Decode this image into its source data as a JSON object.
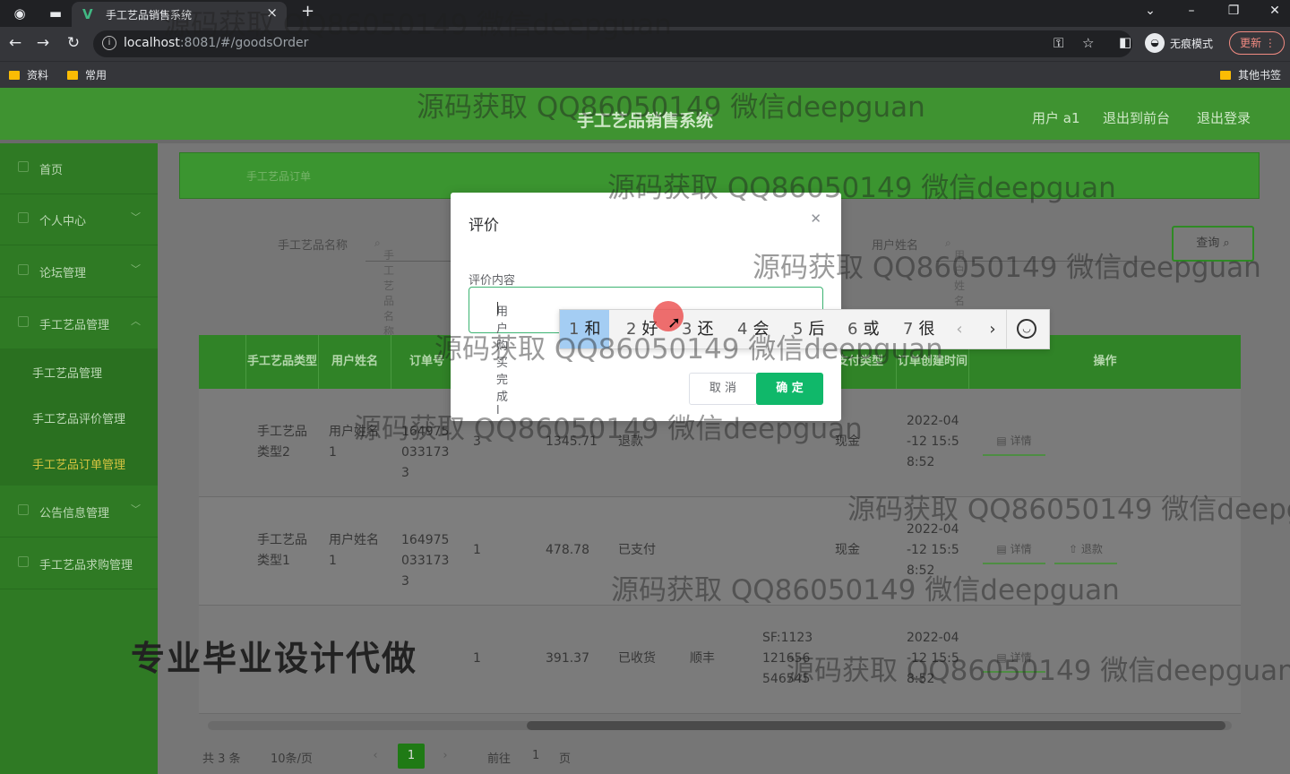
{
  "browser": {
    "tab_title": "手工艺品销售系统",
    "new_tab": "+",
    "url_host": "localhost",
    "url_rest": ":8081/#/goodsOrder",
    "incognito_label": "无痕模式",
    "update_label": "更新",
    "bookmarks": [
      "资料",
      "常用"
    ],
    "other_bookmarks": "其他书签"
  },
  "header": {
    "title": "手工艺品销售系统",
    "user": "用户 a1",
    "front_link": "退出到前台",
    "logout": "退出登录"
  },
  "sidebar": {
    "items": [
      {
        "label": "首页"
      },
      {
        "label": "个人中心"
      },
      {
        "label": "论坛管理"
      },
      {
        "label": "手工艺品管理"
      }
    ],
    "sub_items": [
      {
        "label": "手工艺品管理"
      },
      {
        "label": "手工艺品评价管理"
      },
      {
        "label": "手工艺品订单管理"
      }
    ],
    "items_after": [
      {
        "label": "公告信息管理"
      },
      {
        "label": "手工艺品求购管理"
      }
    ]
  },
  "breadcrumb": "手工艺品订单",
  "search": {
    "name_label": "手工艺品名称",
    "name_placeholder": "手工艺品名称",
    "user_label": "用户姓名",
    "user_placeholder": "用户姓名",
    "query_btn": "查询"
  },
  "table": {
    "headers": [
      "手工艺品类型",
      "用户姓名",
      "订单号",
      "支付类型",
      "订单创建时间",
      "操作"
    ],
    "rows": [
      {
        "type": "手工艺品类型2",
        "user": "用户姓名1",
        "order": "1649750331733",
        "qty": "3",
        "price": "1345.71",
        "status": "退款",
        "courier": "",
        "tracking": "",
        "pay": "现金",
        "time": "2022-04-12 15:58:52",
        "ops": [
          "详情"
        ]
      },
      {
        "type": "手工艺品类型1",
        "user": "用户姓名1",
        "order": "1649750331733",
        "qty": "1",
        "price": "478.78",
        "status": "已支付",
        "courier": "",
        "tracking": "",
        "pay": "现金",
        "time": "2022-04-12 15:58:52",
        "ops": [
          "详情",
          "退款"
        ]
      },
      {
        "type": "",
        "user": "",
        "order": "",
        "qty": "1",
        "price": "391.37",
        "status": "已收货",
        "courier": "顺丰",
        "tracking": "SF:1123121656546545",
        "pay": "",
        "time": "2022-04-12 15:58:52",
        "ops": [
          "详情"
        ]
      }
    ]
  },
  "pagination": {
    "total": "共 3 条",
    "page_size": "10条/页",
    "current": "1",
    "goto_prefix": "前往",
    "goto_value": "1",
    "goto_suffix": "页"
  },
  "dialog": {
    "title": "评价",
    "field_label": "评价内容",
    "field_value": "用户购买完成l",
    "cancel": "取 消",
    "confirm": "确 定"
  },
  "ime": {
    "candidates": [
      {
        "n": "1",
        "w": "和"
      },
      {
        "n": "2",
        "w": "好"
      },
      {
        "n": "3",
        "w": "还"
      },
      {
        "n": "4",
        "w": "会"
      },
      {
        "n": "5",
        "w": "后"
      },
      {
        "n": "6",
        "w": "或"
      },
      {
        "n": "7",
        "w": "很"
      }
    ]
  },
  "watermark": "源码获取 QQ86050149 微信deepguan",
  "watermark_cut": "源码获取 QQ86050149 微信deepgu",
  "ad_text": "专业毕业设计代做"
}
